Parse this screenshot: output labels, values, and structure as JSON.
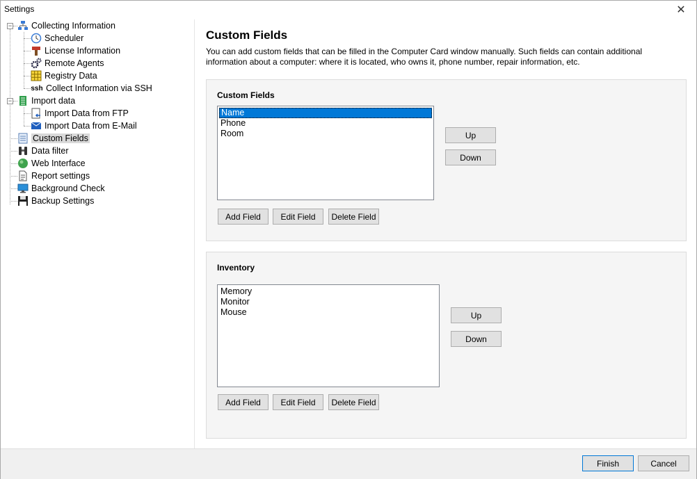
{
  "window": {
    "title": "Settings"
  },
  "tree": {
    "items": [
      {
        "label": "Collecting Information",
        "icon": "network-icon"
      },
      {
        "label": "Scheduler",
        "icon": "clock-icon"
      },
      {
        "label": "License Information",
        "icon": "license-icon"
      },
      {
        "label": "Remote Agents",
        "icon": "gears-icon"
      },
      {
        "label": "Registry Data",
        "icon": "registry-grid-icon"
      },
      {
        "label": "Collect Information via SSH",
        "icon": "ssh-icon",
        "icon_text": "ssh"
      },
      {
        "label": "Import data",
        "icon": "import-icon"
      },
      {
        "label": "Import Data from FTP",
        "icon": "ftp-import-icon"
      },
      {
        "label": "Import Data from E-Mail",
        "icon": "email-import-icon"
      },
      {
        "label": "Custom Fields",
        "icon": "list-icon"
      },
      {
        "label": "Data filter",
        "icon": "binoculars-icon"
      },
      {
        "label": "Web Interface",
        "icon": "globe-icon"
      },
      {
        "label": "Report settings",
        "icon": "report-icon"
      },
      {
        "label": "Background Check",
        "icon": "monitor-icon"
      },
      {
        "label": "Backup Settings",
        "icon": "floppy-icon"
      }
    ],
    "selected": "Custom Fields"
  },
  "main": {
    "title": "Custom Fields",
    "description": "You can add custom fields that can be filled in the Computer Card window manually. Such fields can contain additional information about a computer: where it is located, who owns it, phone number, repair information, etc.",
    "custom_fields": {
      "title": "Custom Fields",
      "items": [
        "Name",
        "Phone",
        "Room"
      ],
      "selected": "Name",
      "up_label": "Up",
      "down_label": "Down",
      "add_label": "Add Field",
      "edit_label": "Edit Field",
      "delete_label": "Delete Field"
    },
    "inventory": {
      "title": "Inventory",
      "items": [
        "Memory",
        "Monitor",
        "Mouse"
      ],
      "up_label": "Up",
      "down_label": "Down",
      "add_label": "Add Field",
      "edit_label": "Edit Field",
      "delete_label": "Delete Field"
    }
  },
  "footer": {
    "finish_label": "Finish",
    "cancel_label": "Cancel"
  },
  "colors": {
    "selection": "#0078d7",
    "button_bg": "#e1e1e1",
    "group_bg": "#f5f5f5"
  }
}
